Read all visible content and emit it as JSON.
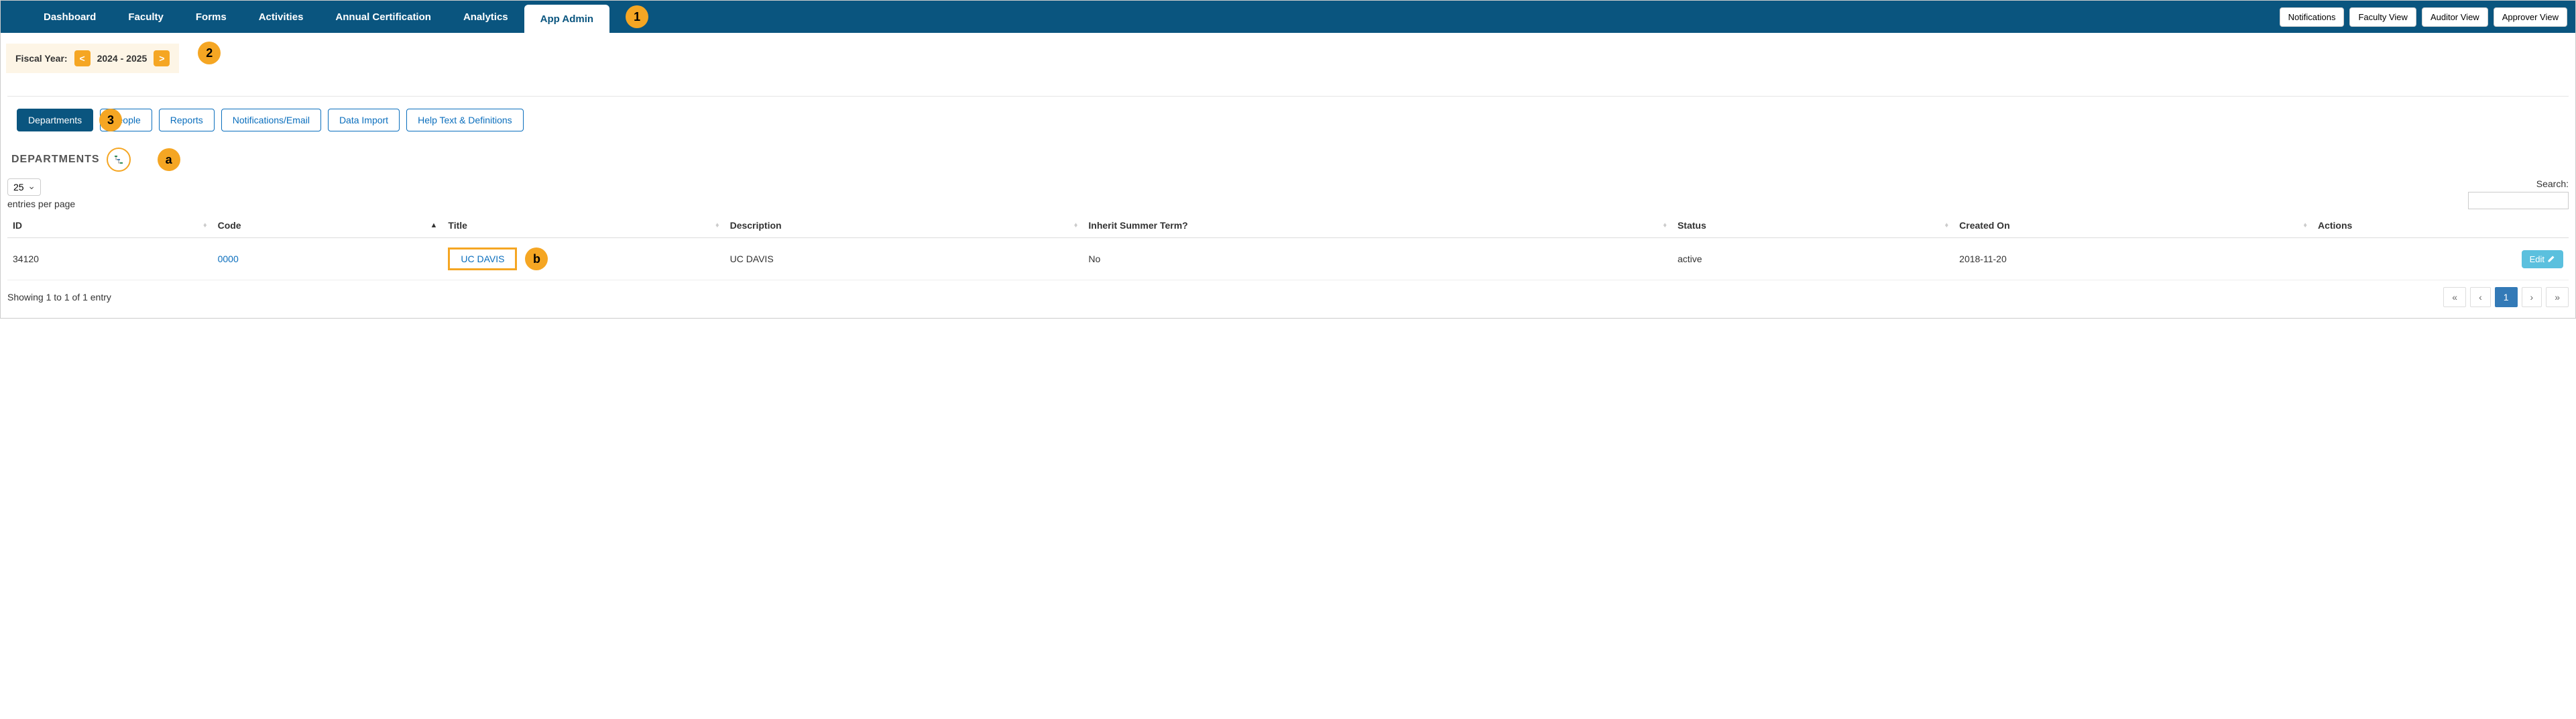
{
  "topnav": {
    "items": [
      "Dashboard",
      "Faculty",
      "Forms",
      "Activities",
      "Annual Certification",
      "Analytics",
      "App Admin"
    ],
    "active_index": 6,
    "right_buttons": [
      "Notifications",
      "Faculty View",
      "Auditor View",
      "Approver View"
    ]
  },
  "callouts": {
    "num1": "1",
    "num2": "2",
    "num3": "3",
    "a": "a",
    "b": "b"
  },
  "fiscal": {
    "label": "Fiscal Year:",
    "prev": "<",
    "value": "2024 - 2025",
    "next": ">"
  },
  "subtabs": {
    "items": [
      "Departments",
      "People",
      "Reports",
      "Notifications/Email",
      "Data Import",
      "Help Text & Definitions"
    ],
    "active_index": 0
  },
  "section": {
    "title": "DEPARTMENTS"
  },
  "table": {
    "page_size": "25",
    "entries_label": "entries per page",
    "search_label": "Search:",
    "search_value": "",
    "headers": [
      "ID",
      "Code",
      "Title",
      "Description",
      "Inherit Summer Term?",
      "Status",
      "Created On",
      "Actions"
    ],
    "rows": [
      {
        "id": "34120",
        "code": "0000",
        "title": "UC DAVIS",
        "description": "UC DAVIS",
        "inherit": "No",
        "status": "active",
        "created_on": "2018-11-20",
        "edit_label": "Edit"
      }
    ],
    "info": "Showing 1 to 1 of 1 entry",
    "pagination": {
      "first": "«",
      "prev": "‹",
      "current": "1",
      "next": "›",
      "last": "»"
    }
  }
}
